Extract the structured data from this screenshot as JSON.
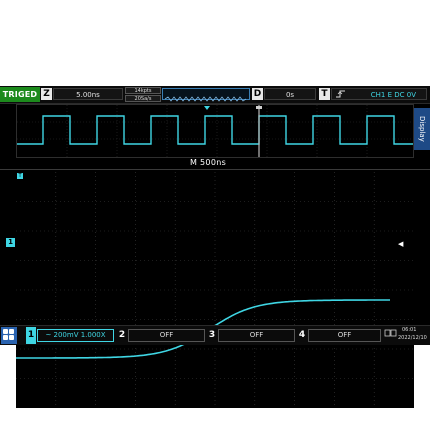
{
  "topbar": {
    "trigger_status": "TRIGED",
    "horizontal_key": "Z",
    "timebase": "5.00ns",
    "sample_points": "14kpts",
    "sample_rate": "20Sa/s",
    "delay_key": "D",
    "delay": "0s",
    "trigger_key": "T",
    "trigger_info": "CH1 E DC 0V"
  },
  "overview": {
    "timebase_label": "M  500ns"
  },
  "side": {
    "display_tab": "Display"
  },
  "markers": {
    "ch1": "1",
    "trigger_level": "T"
  },
  "bottombar": {
    "channels": [
      {
        "num": "1",
        "value": "~ 200mV 1.000X",
        "color": "#3fd6e4"
      },
      {
        "num": "2",
        "value": "OFF",
        "color": "#ffffff"
      },
      {
        "num": "3",
        "value": "OFF",
        "color": "#ffffff"
      },
      {
        "num": "4",
        "value": "OFF",
        "color": "#ffffff"
      }
    ],
    "time": "06:01",
    "date": "2022/12/10"
  },
  "colors": {
    "trace": "#3fd6e4",
    "triged": "#1c8a1c",
    "menu": "#2a63b0",
    "grid": "#3b3b3b"
  }
}
